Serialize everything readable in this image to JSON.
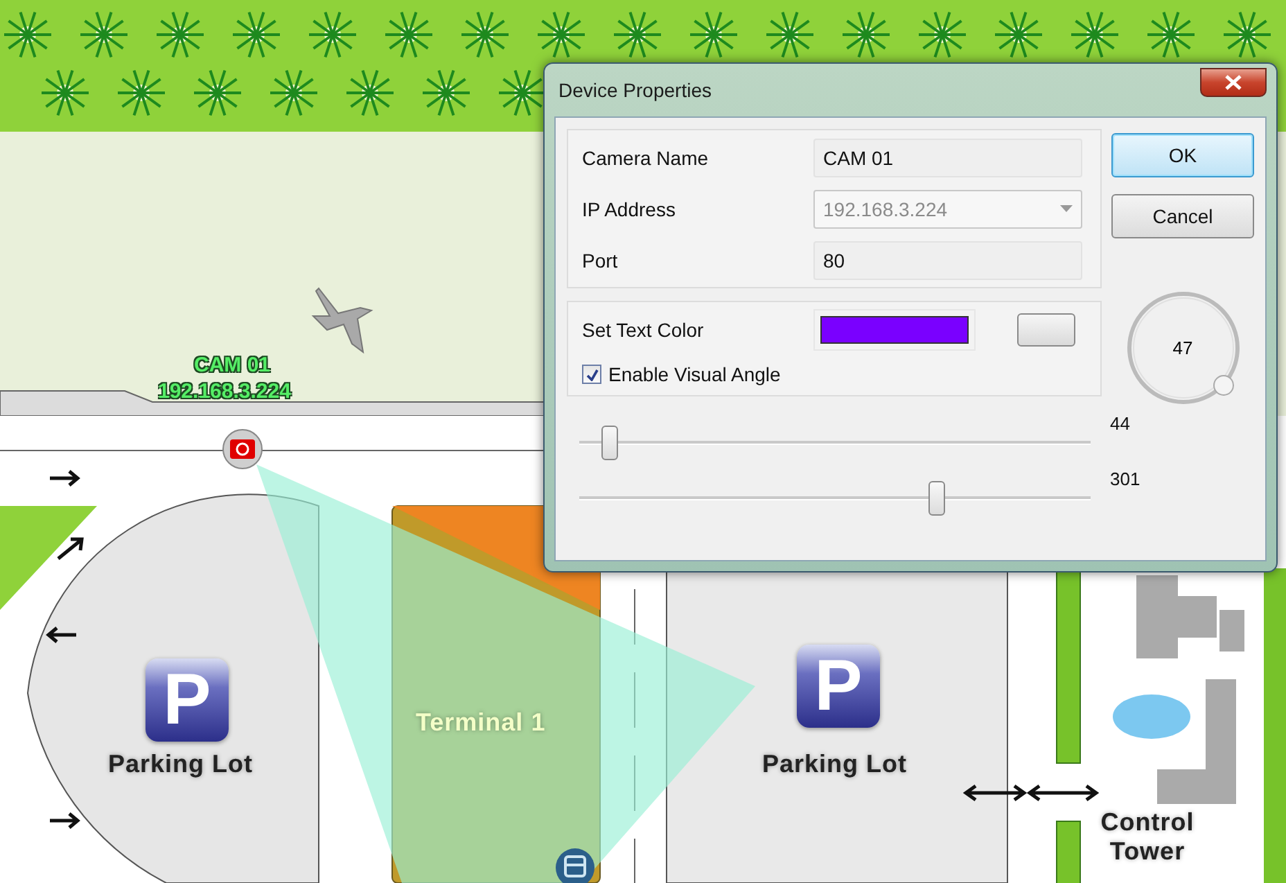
{
  "map": {
    "camera_label": {
      "name": "CAM 01",
      "address": "192.168.3.224",
      "color": "#55ee66"
    },
    "places": [
      {
        "kind": "parking",
        "sign": "P",
        "label": "Parking Lot"
      },
      {
        "kind": "terminal",
        "label": "Terminal 1"
      },
      {
        "kind": "parking",
        "sign": "P",
        "label": "Parking Lot"
      },
      {
        "kind": "tower",
        "label": "Control Tower"
      }
    ]
  },
  "dialog": {
    "title": "Device Properties",
    "fields": [
      {
        "kind": "text",
        "label": "Camera Name",
        "value": "CAM 01",
        "disabled": false
      },
      {
        "kind": "dropdown",
        "label": "IP Address",
        "value": "192.168.3.224",
        "disabled": true
      },
      {
        "kind": "text",
        "label": "Port",
        "value": "80",
        "disabled": false
      }
    ],
    "buttons": [
      {
        "label": "OK",
        "selected": true
      },
      {
        "label": "Cancel",
        "selected": false
      }
    ],
    "dial": {
      "reading": "47"
    },
    "text_color": {
      "label": "Set Text Color",
      "color": "#7a00ff"
    },
    "visual_angle": {
      "label": "Enable Visual Angle",
      "checked": true
    },
    "sliders": [
      {
        "level": 0.06,
        "reading": "44"
      },
      {
        "level": 0.7,
        "reading": "301"
      }
    ]
  }
}
